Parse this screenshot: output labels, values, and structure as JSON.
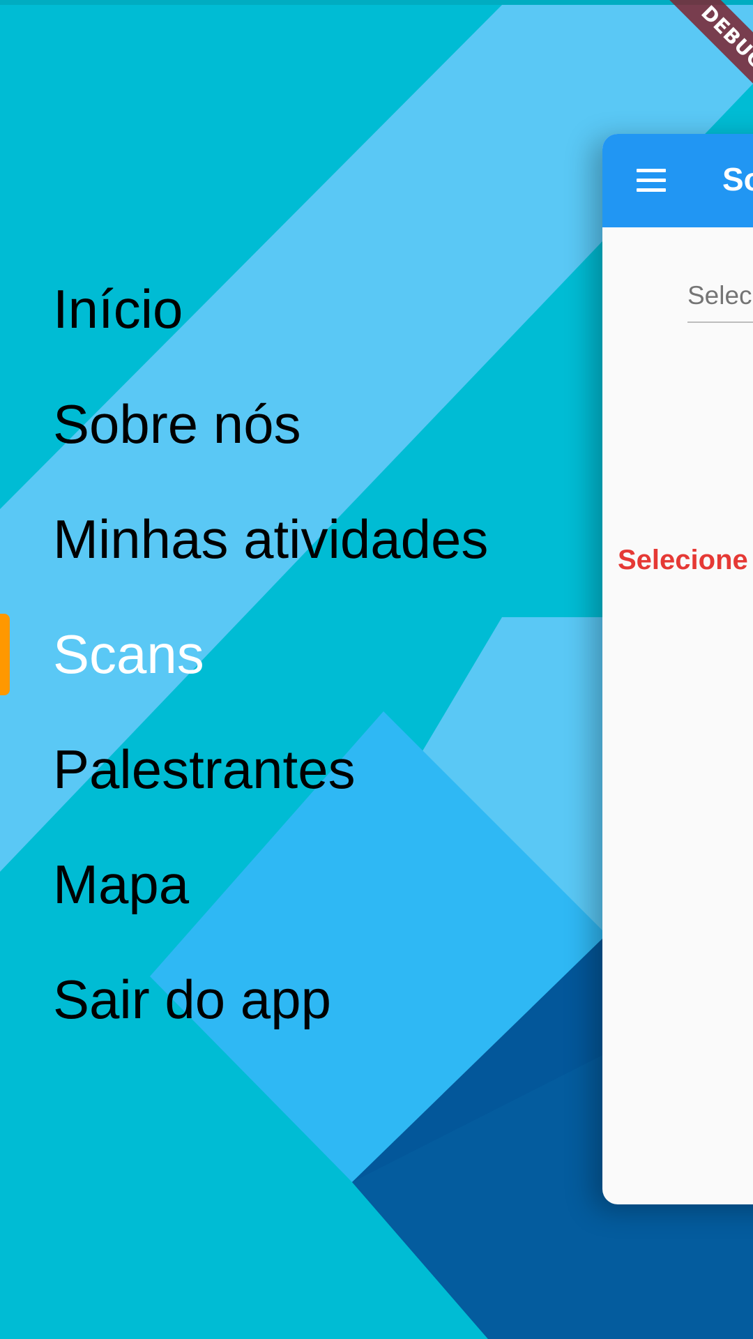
{
  "menu": {
    "items": [
      {
        "label": "Início"
      },
      {
        "label": "Sobre nós"
      },
      {
        "label": "Minhas atividades"
      },
      {
        "label": "Scans"
      },
      {
        "label": "Palestrantes"
      },
      {
        "label": "Mapa"
      },
      {
        "label": "Sair do app"
      }
    ],
    "selected_index": 3
  },
  "page": {
    "appbar_title": "So",
    "select_placeholder": "Selec",
    "warning_text": "Selecione"
  },
  "debug_banner": {
    "label": "DEBUG"
  },
  "colors": {
    "background": "#00BCD4",
    "appbar": "#2196F3",
    "indicator": "#FF9800",
    "warning": "#E53935",
    "banner": "#7E2430"
  },
  "icons": {
    "menu_button": "hamburger-icon"
  }
}
